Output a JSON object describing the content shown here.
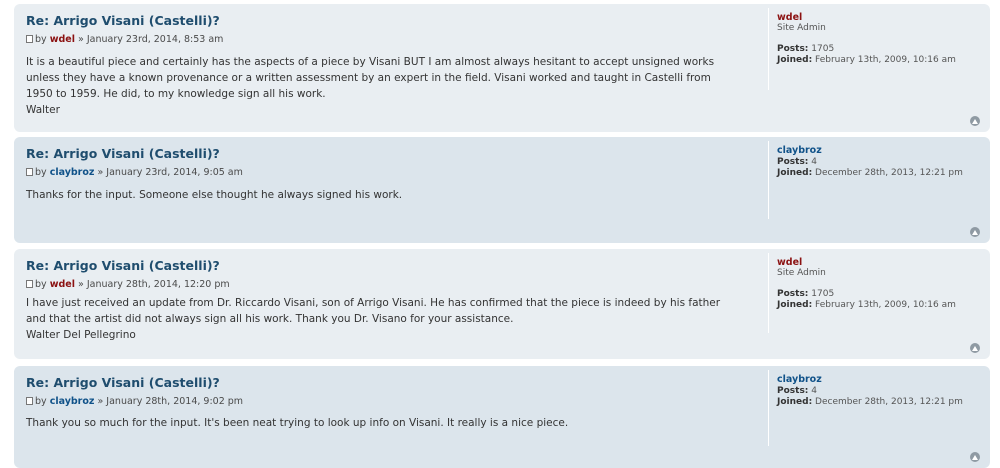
{
  "posts": [
    {
      "title": "Re: Arrigo Visani (Castelli)?",
      "by": "by",
      "author": "wdel",
      "date": "» January 23rd, 2014, 8:53 am",
      "content": [
        "It is a beautiful piece and certainly has the aspects of a piece by Visani BUT I am almost always hesitant to accept unsigned works",
        "unless they have a known provenance or a written assessment by an expert in the field. Visani worked and taught in Castelli from",
        "1950 to 1959. He did, to my knowledge sign all his work.",
        "Walter"
      ],
      "profile": {
        "username": "wdel",
        "rank": "Site Admin",
        "posts_label": "Posts:",
        "posts_value": "1705",
        "joined_label": "Joined:",
        "joined_value": "February 13th, 2009, 10:16 am"
      }
    },
    {
      "title": "Re: Arrigo Visani (Castelli)?",
      "by": "by",
      "author": "claybroz",
      "date": "» January 23rd, 2014, 9:05 am",
      "content": [
        "Thanks for the input. Someone else thought he always signed his work."
      ],
      "profile": {
        "username": "claybroz",
        "rank": "",
        "posts_label": "Posts:",
        "posts_value": "4",
        "joined_label": "Joined:",
        "joined_value": "December 28th, 2013, 12:21 pm"
      }
    },
    {
      "title": "Re: Arrigo Visani (Castelli)?",
      "by": "by",
      "author": "wdel",
      "date": "» January 28th, 2014, 12:20 pm",
      "content": [
        "I have just received an update from Dr. Riccardo Visani, son of Arrigo Visani. He has confirmed that the piece is indeed by his father",
        "and that the artist did not always sign all his work. Thank you Dr. Visano for your assistance.",
        "Walter Del Pellegrino"
      ],
      "profile": {
        "username": "wdel",
        "rank": "Site Admin",
        "posts_label": "Posts:",
        "posts_value": "1705",
        "joined_label": "Joined:",
        "joined_value": "February 13th, 2009, 10:16 am"
      }
    },
    {
      "title": "Re: Arrigo Visani (Castelli)?",
      "by": "by",
      "author": "claybroz",
      "date": "» January 28th, 2014, 9:02 pm",
      "content": [
        "Thank you so much for the input. It's been neat trying to look up info on Visani. It really is a nice piece."
      ],
      "profile": {
        "username": "claybroz",
        "rank": "",
        "posts_label": "Posts:",
        "posts_value": "4",
        "joined_label": "Joined:",
        "joined_value": "December 28th, 2013, 12:21 pm"
      }
    }
  ],
  "icons": {
    "post": "document-icon",
    "top": "back-to-top-icon"
  },
  "colors": {
    "admin": "#8b1111",
    "user": "#105289",
    "title": "#1f4d6e",
    "bg_light": "#e9eef2",
    "bg_dark": "#dce5ec"
  }
}
